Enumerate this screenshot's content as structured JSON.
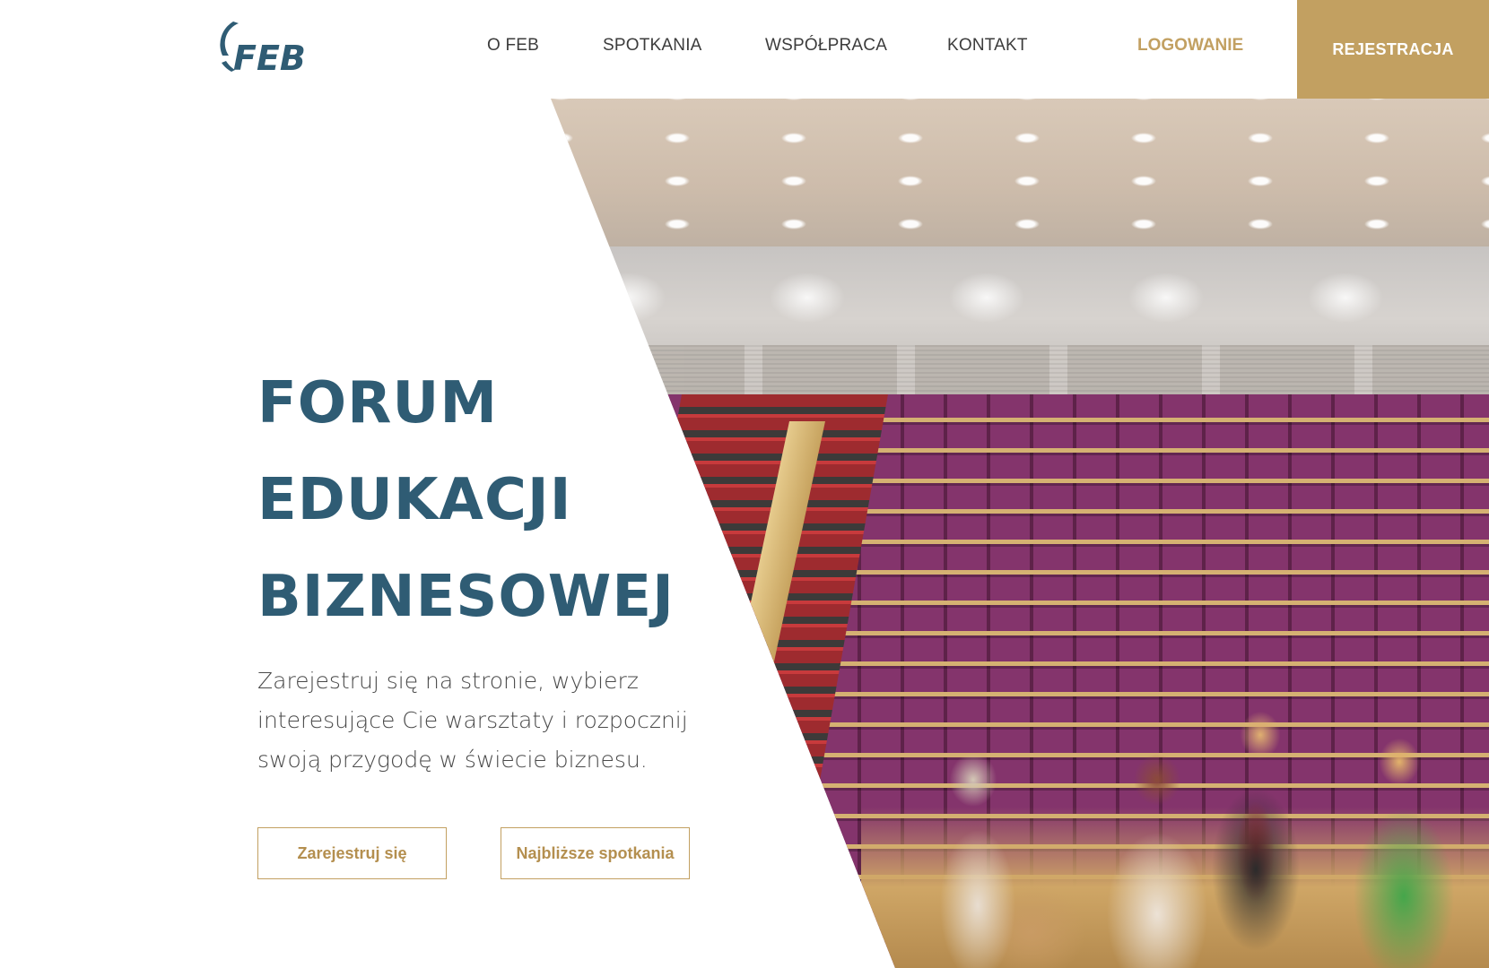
{
  "header": {
    "logo_text": "FEB",
    "nav": {
      "about": "O FEB",
      "meetings": "SPOTKANIA",
      "cooperation": "WSPÓŁPRACA",
      "contact": "KONTAKT"
    },
    "login": "LOGOWANIE",
    "register": "REJESTRACJA"
  },
  "hero": {
    "title_lines": [
      "FORUM",
      "EDUKACJI",
      "BIZNESOWEJ"
    ],
    "description": "Zarejestruj się na stronie, wybierz interesujące Cie warsztaty i rozpocznij swoją przygodę w świecie biznesu.",
    "buttons": {
      "register": "Zarejestruj się",
      "meetings": "Najbliższe spotkania"
    }
  },
  "colors": {
    "primary_blue": "#2f5c74",
    "accent_gold": "#c2a061",
    "text_dark": "#3c3c3c"
  }
}
